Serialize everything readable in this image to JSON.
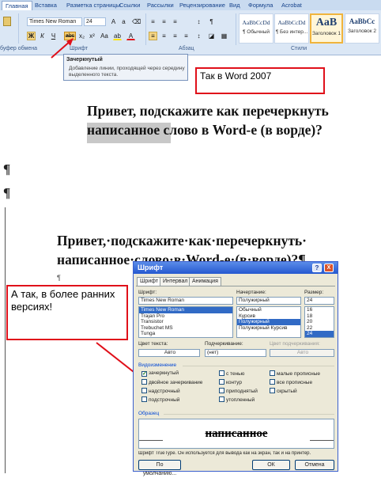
{
  "ribbon": {
    "tabs": [
      "Главная",
      "Вставка",
      "Разметка страницы",
      "Ссылки",
      "Рассылки",
      "Рецензирование",
      "Вид",
      "Формула",
      "Acrobat"
    ],
    "font_name": "Times New Roman",
    "font_size": "24",
    "groups": {
      "font": "Шрифт",
      "paragraph": "Абзац",
      "styles": "Стили",
      "clipboard": "буфер обмена"
    },
    "styles": [
      {
        "sample": "AaBbCcDd",
        "name": "¶ Обычный"
      },
      {
        "sample": "AaBbCcDd",
        "name": "¶ Без интер..."
      },
      {
        "sample": "AaB",
        "name": "Заголовок 1"
      },
      {
        "sample": "AaBbCc",
        "name": "Заголовок 2"
      }
    ],
    "buttons": {
      "bold": "Ж",
      "italic": "К",
      "underline": "Ч",
      "strikethrough": "abc",
      "subscript": "x₂",
      "superscript": "x²",
      "change_case": "Aa",
      "highlight": "ab",
      "font_color": "A"
    }
  },
  "tooltip": {
    "title": "Зачеркнутый",
    "body": "Добавление линии, проходящей через середину выделенного текста."
  },
  "callouts": {
    "word2007": "Так в Word 2007",
    "older": "А так, в более ранних версиях!"
  },
  "document": {
    "text_top_line1": "Привет, подскажите как перечеркнуть",
    "text_top_line2": "написанное слово в Word-е (в ворде)?",
    "pilcrow": "¶",
    "text_bottom_line1": "Привет,·подскажите·как·перечеркнуть·",
    "text_bottom_line2": "написанное·слово·в·Word-е·(в·ворде)?¶"
  },
  "dialog": {
    "title": "Шрифт",
    "help": "?",
    "close": "X",
    "tabs": [
      "Шрифт",
      "Интервал",
      "Анимация"
    ],
    "font_label": "Шрифт:",
    "font_value": "Times New Roman",
    "font_list": [
      "Times New Roman",
      "Trajan Pro",
      "Transistor",
      "Trebuchet MS",
      "Tunga"
    ],
    "style_label": "Начертание:",
    "style_value": "Полужирный",
    "style_list": [
      "Обычный",
      "Курсив",
      "Полужирный",
      "Полужирный Курсив"
    ],
    "size_label": "Размер:",
    "size_value": "24",
    "size_list": [
      "16",
      "18",
      "20",
      "22",
      "24"
    ],
    "color_label": "Цвет текста:",
    "color_value": "Авто",
    "underline_label": "Подчеркивание:",
    "underline_value": "(нет)",
    "underline_color_label": "Цвет подчеркивания:",
    "underline_color_value": "Авто",
    "effects_label": "Видоизменение",
    "effects": [
      {
        "label": "зачеркнутый",
        "checked": true
      },
      {
        "label": "двойное зачеркивание",
        "checked": false
      },
      {
        "label": "надстрочный",
        "checked": false
      },
      {
        "label": "подстрочный",
        "checked": false
      },
      {
        "label": "с тенью",
        "checked": false
      },
      {
        "label": "контур",
        "checked": false
      },
      {
        "label": "приподнятый",
        "checked": false
      },
      {
        "label": "утопленный",
        "checked": false
      },
      {
        "label": "малые прописные",
        "checked": false
      },
      {
        "label": "все прописные",
        "checked": false
      },
      {
        "label": "скрытый",
        "checked": false
      }
    ],
    "sample_label": "Образец",
    "sample_text": "написанное",
    "footer_note": "Шрифт TrueType. Он используется для вывода как на экран, так и на принтер.",
    "default_button": "По умолчанию...",
    "ok_button": "ОК",
    "cancel_button": "Отмена"
  },
  "colors": {
    "callout_border": "#e0101a",
    "ribbon_bg": "#dbe7f5",
    "accent": "#15428b"
  }
}
